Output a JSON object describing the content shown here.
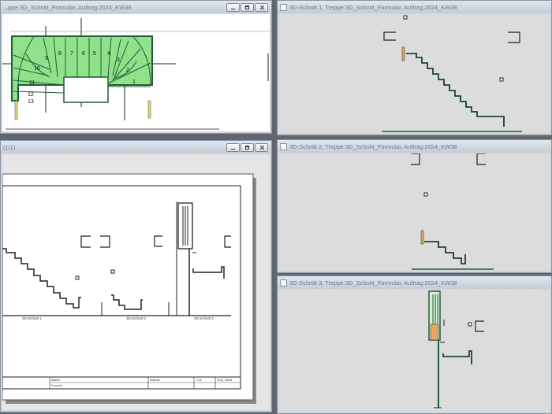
{
  "windows": {
    "plan": {
      "title": "...ppe:3D_Schnitt_Formular, Auftrag:2024_KW38"
    },
    "layout": {
      "title": "(1/1)"
    },
    "section1": {
      "title": "3D-Schnitt 1, Treppe:3D_Schnitt_Formular, Auftrag:2024_KW38"
    },
    "section2": {
      "title": "3D-Schnitt 2, Treppe:3D_Schnitt_Formular, Auftrag:2024_KW38"
    },
    "section3": {
      "title": "3D-Schnitt 3, Treppe:3D_Schnitt_Formular, Auftrag:2024_KW38"
    }
  },
  "plan": {
    "step_numbers": [
      "1",
      "2",
      "3",
      "4",
      "5",
      "6",
      "7",
      "8",
      "9",
      "10",
      "11",
      "12",
      "13"
    ],
    "tread_color": "#8fe28a"
  },
  "layout": {
    "labels": [
      "3D-Schnitt 1",
      "3D-Schnitt 2",
      "3D-Schnitt 3"
    ],
    "titleblock_labels": [
      "Bauteil",
      "Formular",
      "Material",
      "1:20",
      "2024_KW38"
    ]
  },
  "colors": {
    "stair_line": "#1f5c3a",
    "wood": "#e8a860",
    "panel_gray": "#dcdcdc"
  }
}
